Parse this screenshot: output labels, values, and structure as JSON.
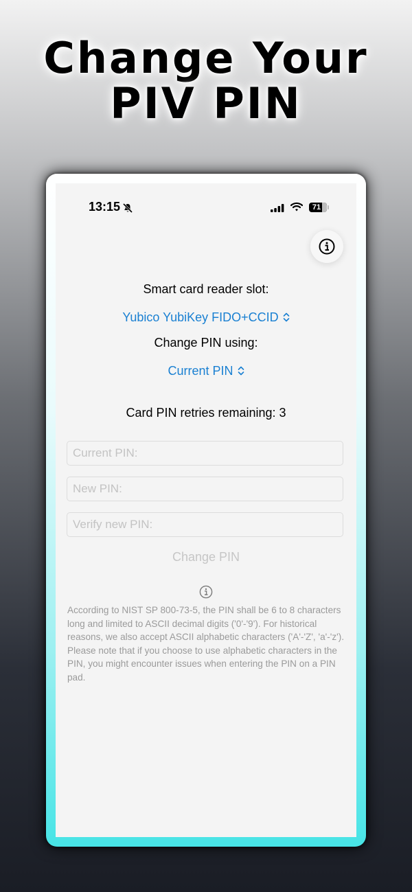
{
  "headline": {
    "line1": "Change Your",
    "line2": "PIV PIN"
  },
  "statusbar": {
    "time": "13:15",
    "battery": "71"
  },
  "form": {
    "slot_label": "Smart card reader slot:",
    "slot_value": "Yubico YubiKey FIDO+CCID",
    "method_label": "Change PIN using:",
    "method_value": "Current PIN",
    "retries": "Card PIN retries remaining: 3",
    "current_placeholder": "Current PIN:",
    "new_placeholder": "New PIN:",
    "verify_placeholder": "Verify new PIN:",
    "change_button": "Change PIN"
  },
  "note": {
    "line1": "According to NIST SP 800-73-5, the PIN shall be 6 to 8 characters long and limited to ASCII decimal digits ('0'-'9'). For historical reasons, we also accept ASCII alphabetic characters ('A'-'Z', 'a'-'z').",
    "line2": "Please note that if you choose to use alphabetic characters in the PIN, you might encounter issues when entering the PIN on a PIN pad."
  },
  "colors": {
    "accent": "#1a80d2",
    "frame_bottom": "#47e4e6"
  },
  "icons": [
    "bell-slash-icon",
    "cellular-signal-icon",
    "wifi-icon",
    "battery-icon",
    "info-icon",
    "chevron-up-down-icon"
  ]
}
